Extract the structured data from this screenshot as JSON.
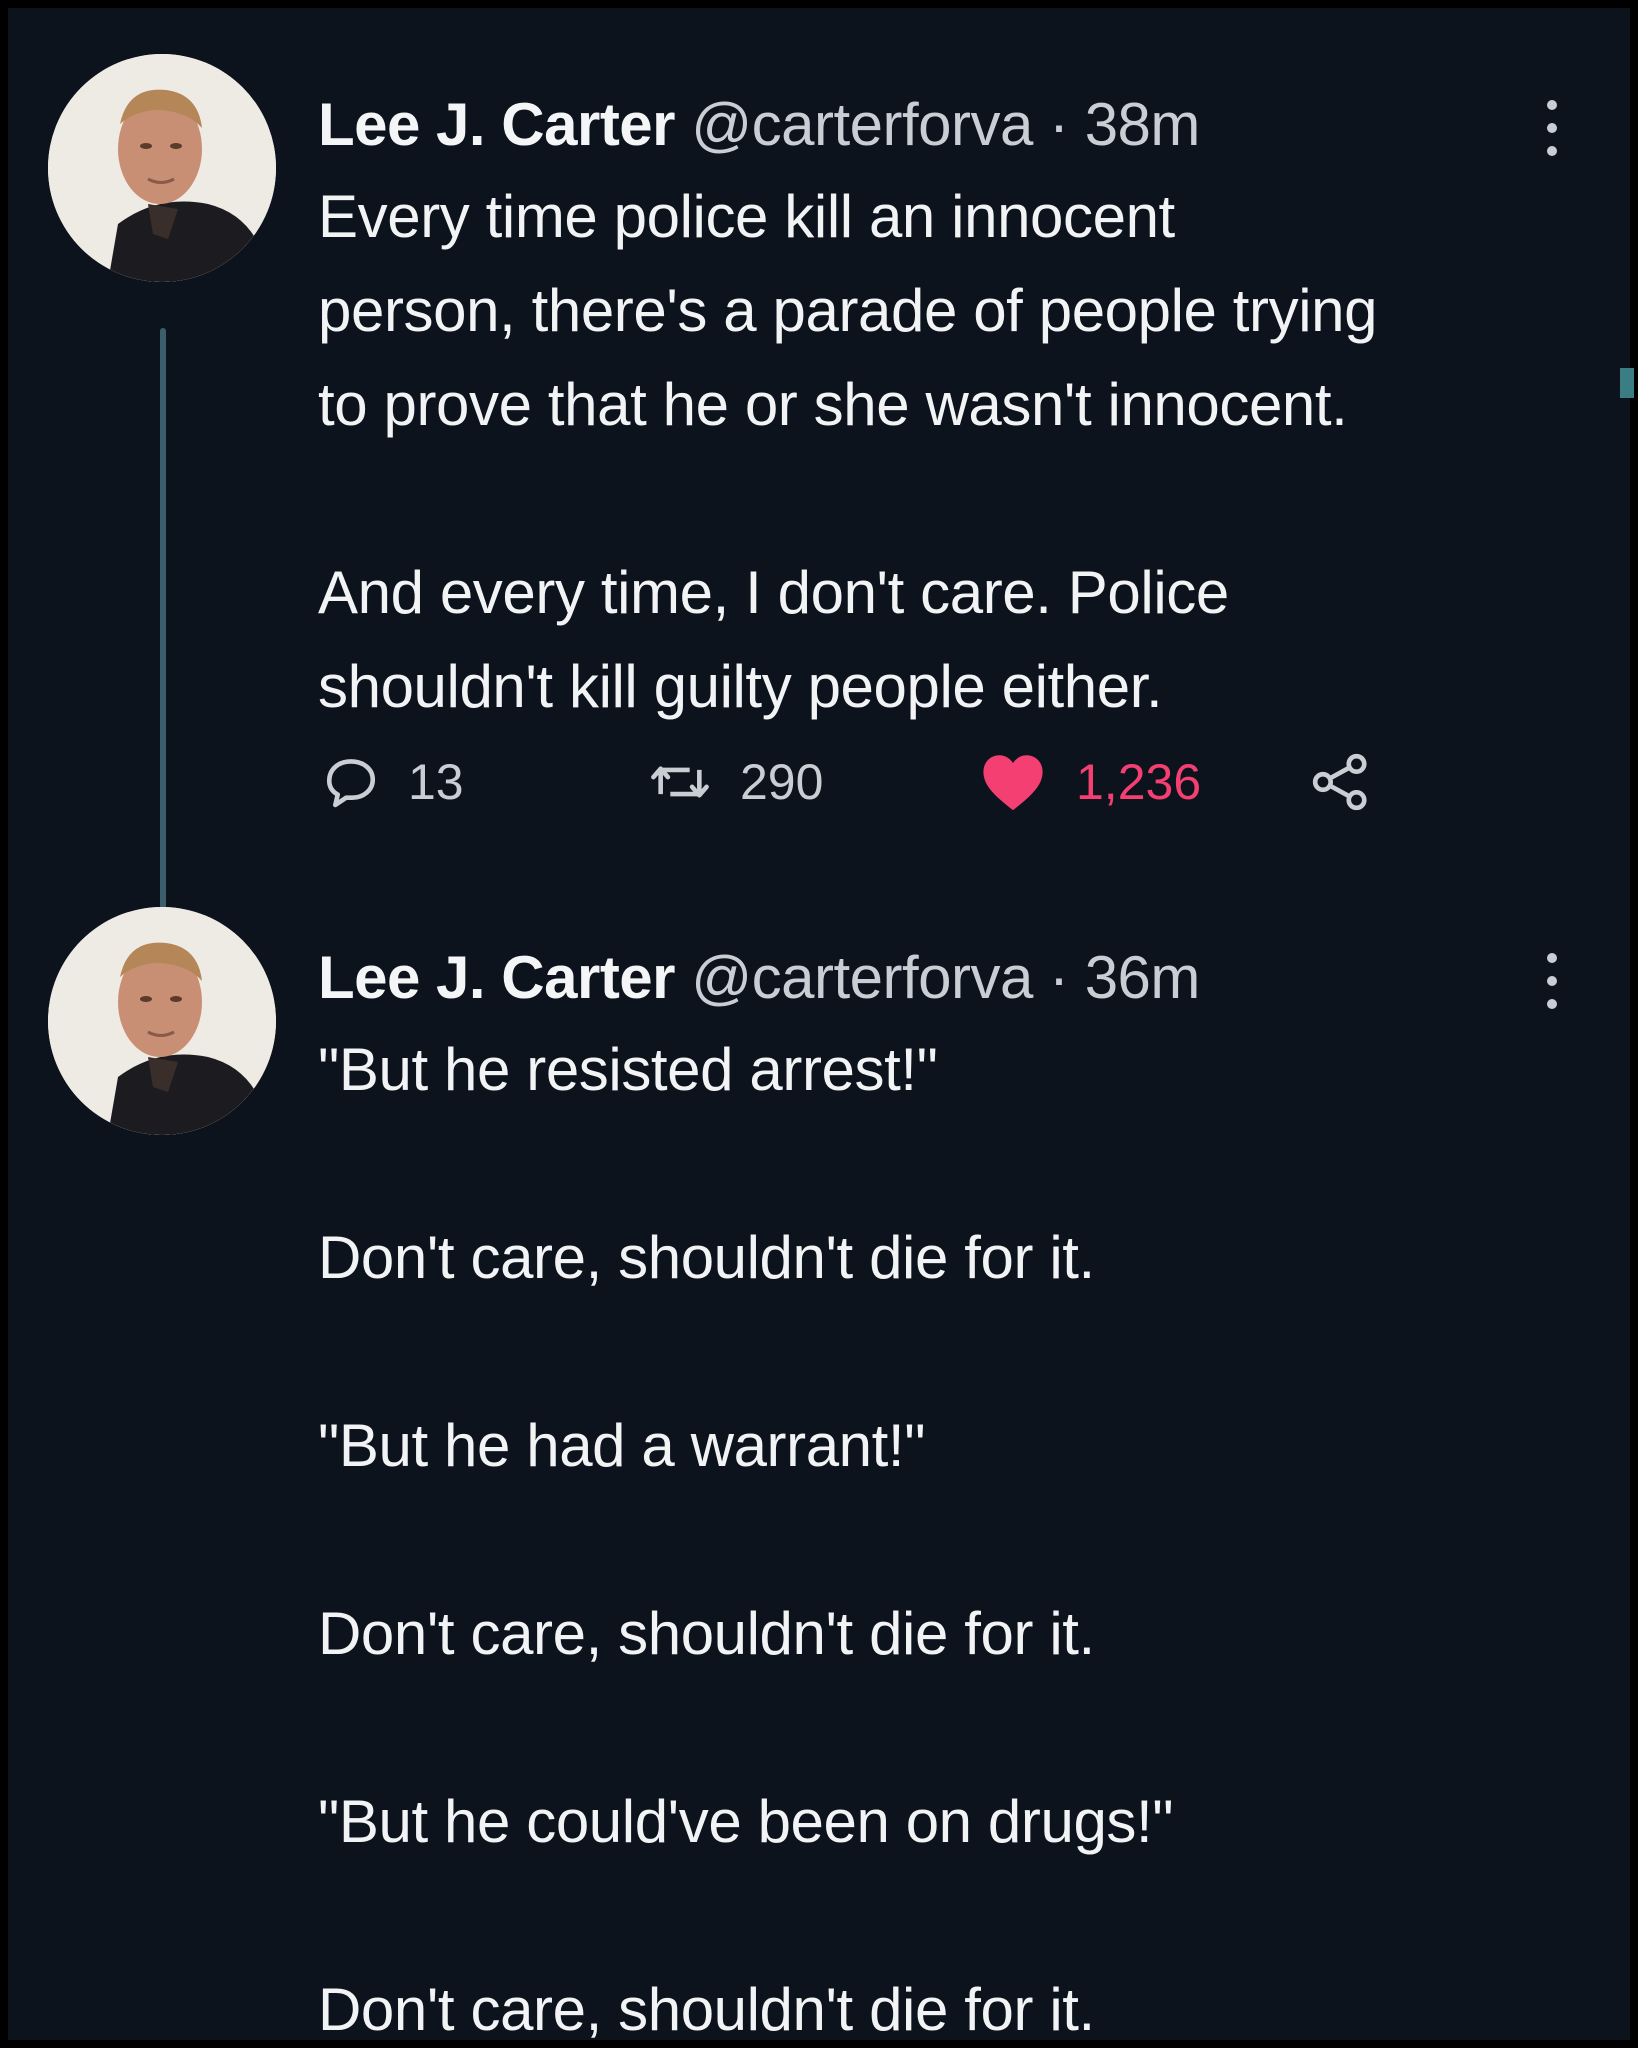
{
  "tweets": [
    {
      "name": "Lee J. Carter",
      "handle": "@carterforva",
      "separator": "·",
      "time": "38m",
      "body": [
        "Every time police kill an innocent",
        "person, there's a parade of people trying",
        "to prove that he or she wasn't innocent.",
        "",
        "And every time, I don't care.  Police",
        "shouldn't kill guilty people either."
      ],
      "actions": {
        "replies": "13",
        "retweets": "290",
        "likes": "1,236",
        "liked": true
      }
    },
    {
      "name": "Lee J. Carter",
      "handle": "@carterforva",
      "separator": "·",
      "time": "36m",
      "body": [
        "\"But he resisted arrest!\"",
        "",
        "Don't care, shouldn't die for it.",
        "",
        "\"But he had a warrant!\"",
        "",
        "Don't care, shouldn't die for it.",
        "",
        "\"But he could've been on drugs!\"",
        "",
        "Don't care, shouldn't die for it."
      ]
    }
  ],
  "colors": {
    "background": "#0d131c",
    "text": "#f1f3f5",
    "secondary_text": "#c9ced4",
    "like": "#f43f72",
    "thread_line": "#3b5f6a"
  },
  "icons": [
    "more-options-icon",
    "reply-icon",
    "retweet-icon",
    "heart-icon",
    "share-icon"
  ]
}
